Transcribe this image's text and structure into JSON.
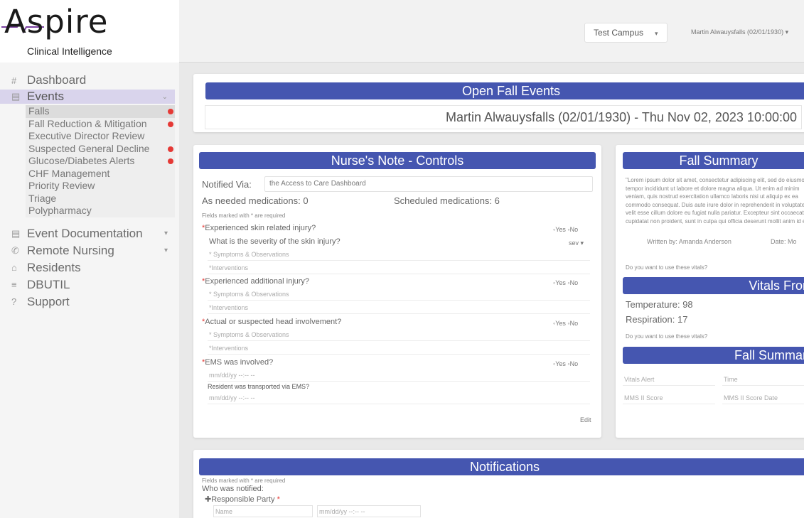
{
  "logo": {
    "brand": "Aspire",
    "tagline": "Clinical Intelligence"
  },
  "header": {
    "campus": "Test Campus",
    "user": "Martin Alwauysfalls (02/01/1930) ▾"
  },
  "sidebar": {
    "items": [
      {
        "icon": "#",
        "label": "Dashboard"
      },
      {
        "icon": "▤",
        "label": "Events",
        "chevron": "⌄"
      },
      {
        "icon": "▤",
        "label": "Event Documentation",
        "chevron": "▾"
      },
      {
        "icon": "✆",
        "label": "Remote Nursing",
        "chevron": "▾"
      },
      {
        "icon": "⌂",
        "label": "Residents"
      },
      {
        "icon": "≡",
        "label": "DBUTIL"
      },
      {
        "icon": "?",
        "label": "Support"
      }
    ],
    "event_subitems": [
      "Falls",
      "Fall Reduction & Mitigation",
      "Executive Director Review",
      "Suspected General Decline",
      "Glucose/Diabetes Alerts",
      "CHF Management",
      "Priority Review",
      "Triage",
      "Polypharmacy"
    ]
  },
  "open_fall": {
    "title": "Open Fall Events",
    "event": "Martin Alwauysfalls (02/01/1930) - Thu Nov 02, 2023 10:00:00"
  },
  "nurse_note": {
    "title": "Nurse's Note - Controls",
    "notified_label": "Notified Via:",
    "notified_value": "the Access to Care Dashboard",
    "as_needed": "As needed medications: 0",
    "scheduled": "Scheduled medications: 6",
    "required_note": "Fields marked with * are required",
    "q_skin": "Experienced skin related injury?",
    "q_severity": "What is the severity of the skin injury?",
    "severity_select": "sev ▾",
    "q_additional": "Experienced additional injury?",
    "q_head": "Actual or suspected head involvement?",
    "q_ems": "EMS was involved?",
    "q_transported": "Resident was transported via EMS?",
    "symptoms": "* Symptoms & Observations",
    "interventions": "*Interventions",
    "yes_no": "◦Yes ◦No",
    "date_placeholder": "mm/dd/yy --:-- --",
    "save": "Edit"
  },
  "fall_summary": {
    "title": "Fall Summary",
    "body": "\"Lorem ipsum dolor sit amet, consectetur adipiscing elit, sed do eiusmod tempor incididunt ut labore et dolore magna aliqua. Ut enim ad minim veniam, quis nostrud exercitation ullamco laboris nisi ut aliquip ex ea commodo consequat. Duis aute irure dolor in reprehenderit in voluptate velit esse cillum dolore eu fugiat nulla pariatur. Excepteur sint occaecat cupidatat non proident, sunt in culpa qui officia deserunt mollit anim id est laborum.\"",
    "written_by": "Written by: Amanda Anderson",
    "date": "Date: Mo",
    "use_vitals_q": "Do you want to use these vitals?",
    "vitals_title": "Vitals From",
    "temperature": "Temperature: 98",
    "respiration": "Respiration: 17",
    "use_vitals_q2": "Do you want to use these vitals?",
    "summary2_title": "Fall Summary",
    "f1": "Vitals Alert",
    "f2": "Time",
    "f3": "MMS II Score",
    "f4": "MMS II Score Date"
  },
  "notifications": {
    "title": "Notifications",
    "required_note": "Fields marked with * are required",
    "who": "Who was notified:",
    "responsible": "Responsible Party",
    "name_ph": "Name",
    "date_ph": "mm/dd/yy --:-- --"
  }
}
